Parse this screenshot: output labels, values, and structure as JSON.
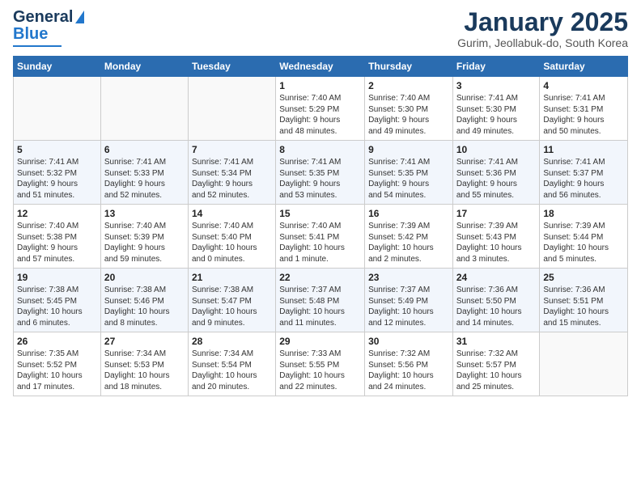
{
  "header": {
    "logo_line1": "General",
    "logo_line2": "Blue",
    "month": "January 2025",
    "location": "Gurim, Jeollabuk-do, South Korea"
  },
  "days_of_week": [
    "Sunday",
    "Monday",
    "Tuesday",
    "Wednesday",
    "Thursday",
    "Friday",
    "Saturday"
  ],
  "weeks": [
    [
      {
        "day": "",
        "text": ""
      },
      {
        "day": "",
        "text": ""
      },
      {
        "day": "",
        "text": ""
      },
      {
        "day": "1",
        "text": "Sunrise: 7:40 AM\nSunset: 5:29 PM\nDaylight: 9 hours\nand 48 minutes."
      },
      {
        "day": "2",
        "text": "Sunrise: 7:40 AM\nSunset: 5:30 PM\nDaylight: 9 hours\nand 49 minutes."
      },
      {
        "day": "3",
        "text": "Sunrise: 7:41 AM\nSunset: 5:30 PM\nDaylight: 9 hours\nand 49 minutes."
      },
      {
        "day": "4",
        "text": "Sunrise: 7:41 AM\nSunset: 5:31 PM\nDaylight: 9 hours\nand 50 minutes."
      }
    ],
    [
      {
        "day": "5",
        "text": "Sunrise: 7:41 AM\nSunset: 5:32 PM\nDaylight: 9 hours\nand 51 minutes."
      },
      {
        "day": "6",
        "text": "Sunrise: 7:41 AM\nSunset: 5:33 PM\nDaylight: 9 hours\nand 52 minutes."
      },
      {
        "day": "7",
        "text": "Sunrise: 7:41 AM\nSunset: 5:34 PM\nDaylight: 9 hours\nand 52 minutes."
      },
      {
        "day": "8",
        "text": "Sunrise: 7:41 AM\nSunset: 5:35 PM\nDaylight: 9 hours\nand 53 minutes."
      },
      {
        "day": "9",
        "text": "Sunrise: 7:41 AM\nSunset: 5:35 PM\nDaylight: 9 hours\nand 54 minutes."
      },
      {
        "day": "10",
        "text": "Sunrise: 7:41 AM\nSunset: 5:36 PM\nDaylight: 9 hours\nand 55 minutes."
      },
      {
        "day": "11",
        "text": "Sunrise: 7:41 AM\nSunset: 5:37 PM\nDaylight: 9 hours\nand 56 minutes."
      }
    ],
    [
      {
        "day": "12",
        "text": "Sunrise: 7:40 AM\nSunset: 5:38 PM\nDaylight: 9 hours\nand 57 minutes."
      },
      {
        "day": "13",
        "text": "Sunrise: 7:40 AM\nSunset: 5:39 PM\nDaylight: 9 hours\nand 59 minutes."
      },
      {
        "day": "14",
        "text": "Sunrise: 7:40 AM\nSunset: 5:40 PM\nDaylight: 10 hours\nand 0 minutes."
      },
      {
        "day": "15",
        "text": "Sunrise: 7:40 AM\nSunset: 5:41 PM\nDaylight: 10 hours\nand 1 minute."
      },
      {
        "day": "16",
        "text": "Sunrise: 7:39 AM\nSunset: 5:42 PM\nDaylight: 10 hours\nand 2 minutes."
      },
      {
        "day": "17",
        "text": "Sunrise: 7:39 AM\nSunset: 5:43 PM\nDaylight: 10 hours\nand 3 minutes."
      },
      {
        "day": "18",
        "text": "Sunrise: 7:39 AM\nSunset: 5:44 PM\nDaylight: 10 hours\nand 5 minutes."
      }
    ],
    [
      {
        "day": "19",
        "text": "Sunrise: 7:38 AM\nSunset: 5:45 PM\nDaylight: 10 hours\nand 6 minutes."
      },
      {
        "day": "20",
        "text": "Sunrise: 7:38 AM\nSunset: 5:46 PM\nDaylight: 10 hours\nand 8 minutes."
      },
      {
        "day": "21",
        "text": "Sunrise: 7:38 AM\nSunset: 5:47 PM\nDaylight: 10 hours\nand 9 minutes."
      },
      {
        "day": "22",
        "text": "Sunrise: 7:37 AM\nSunset: 5:48 PM\nDaylight: 10 hours\nand 11 minutes."
      },
      {
        "day": "23",
        "text": "Sunrise: 7:37 AM\nSunset: 5:49 PM\nDaylight: 10 hours\nand 12 minutes."
      },
      {
        "day": "24",
        "text": "Sunrise: 7:36 AM\nSunset: 5:50 PM\nDaylight: 10 hours\nand 14 minutes."
      },
      {
        "day": "25",
        "text": "Sunrise: 7:36 AM\nSunset: 5:51 PM\nDaylight: 10 hours\nand 15 minutes."
      }
    ],
    [
      {
        "day": "26",
        "text": "Sunrise: 7:35 AM\nSunset: 5:52 PM\nDaylight: 10 hours\nand 17 minutes."
      },
      {
        "day": "27",
        "text": "Sunrise: 7:34 AM\nSunset: 5:53 PM\nDaylight: 10 hours\nand 18 minutes."
      },
      {
        "day": "28",
        "text": "Sunrise: 7:34 AM\nSunset: 5:54 PM\nDaylight: 10 hours\nand 20 minutes."
      },
      {
        "day": "29",
        "text": "Sunrise: 7:33 AM\nSunset: 5:55 PM\nDaylight: 10 hours\nand 22 minutes."
      },
      {
        "day": "30",
        "text": "Sunrise: 7:32 AM\nSunset: 5:56 PM\nDaylight: 10 hours\nand 24 minutes."
      },
      {
        "day": "31",
        "text": "Sunrise: 7:32 AM\nSunset: 5:57 PM\nDaylight: 10 hours\nand 25 minutes."
      },
      {
        "day": "",
        "text": ""
      }
    ]
  ]
}
